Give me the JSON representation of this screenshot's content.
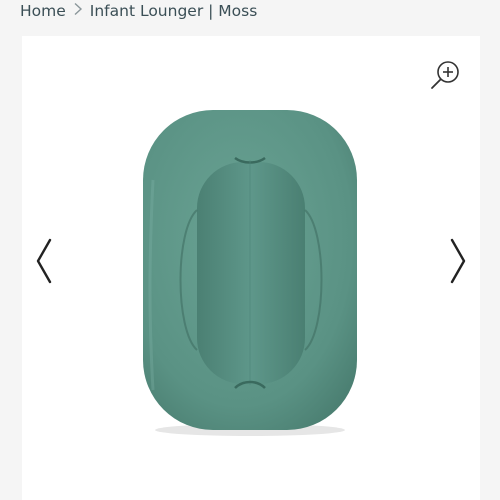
{
  "breadcrumb": {
    "home_label": "Home",
    "separator_icon": "chevron-right-icon",
    "current_label": "Infant Lounger | Moss"
  },
  "gallery": {
    "zoom_icon": "zoom-in-icon",
    "prev_icon": "chevron-left-icon",
    "next_icon": "chevron-right-icon",
    "product_color": "#5a9284"
  },
  "colors": {
    "page_background": "#f5f5f5",
    "gallery_background": "#ffffff",
    "text": "#3b4f56",
    "icon": "#333333"
  }
}
